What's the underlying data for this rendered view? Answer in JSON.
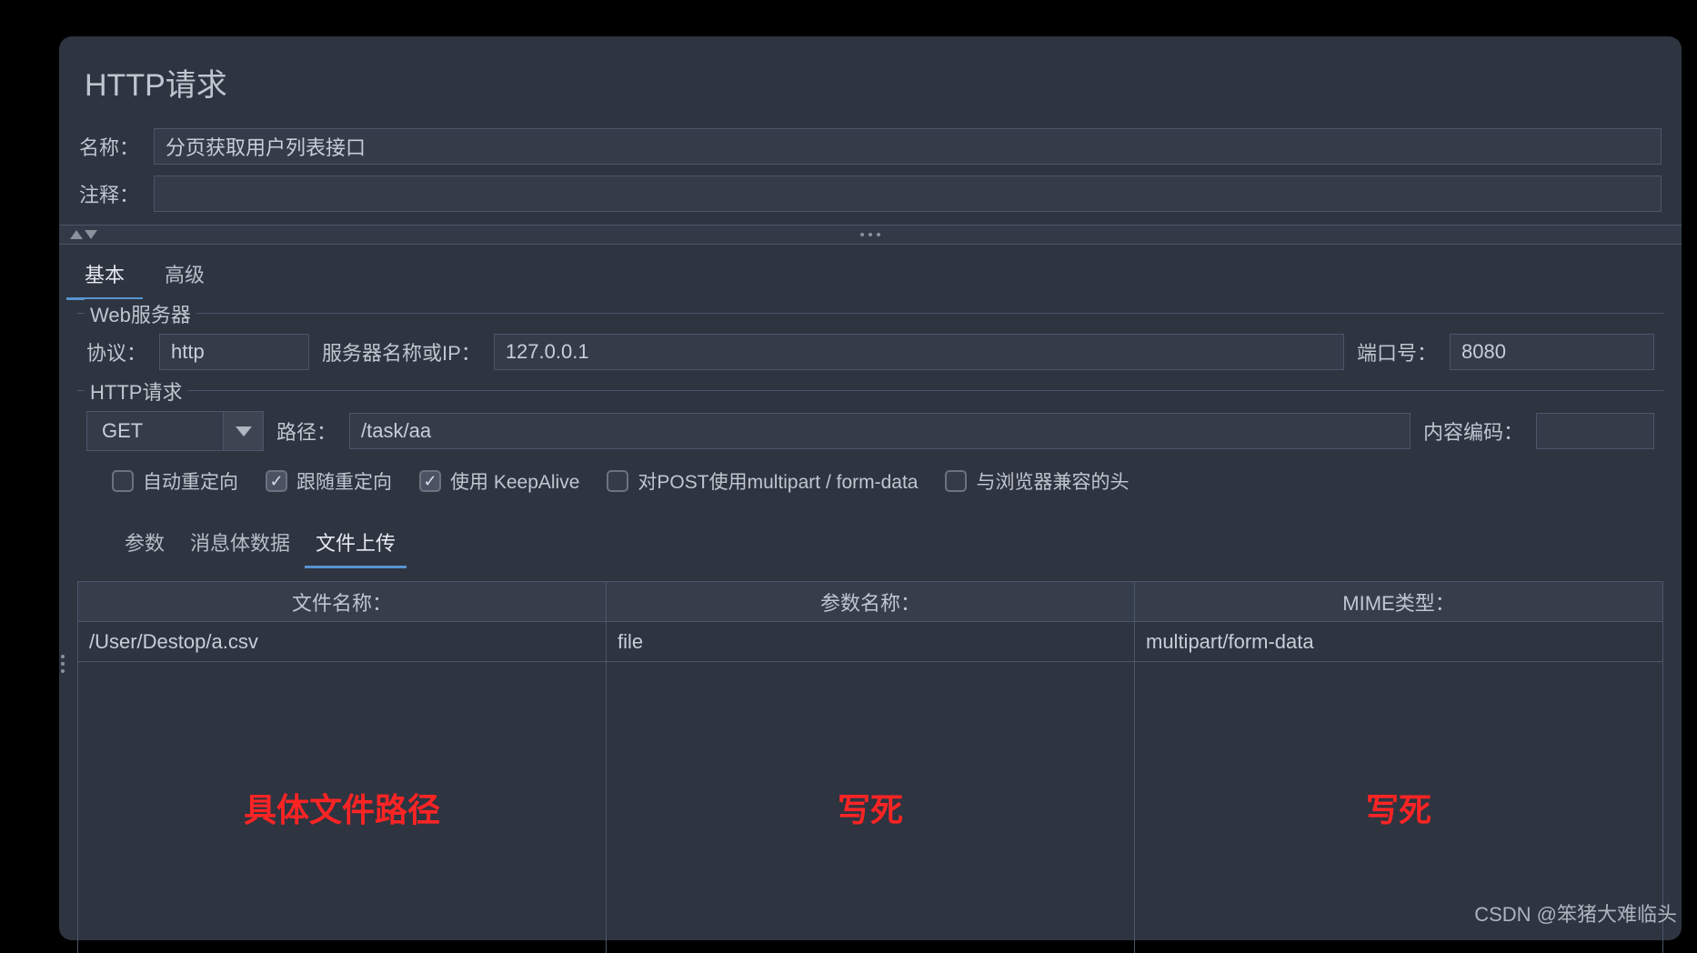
{
  "header": {
    "title": "HTTP请求",
    "name_label": "名称：",
    "name_value": "分页获取用户列表接口",
    "comment_label": "注释：",
    "comment_value": ""
  },
  "tabs": {
    "main": [
      "基本",
      "高级"
    ],
    "active_main": 0
  },
  "web_server": {
    "legend": "Web服务器",
    "protocol_label": "协议：",
    "protocol_value": "http",
    "server_label": "服务器名称或IP：",
    "server_value": "127.0.0.1",
    "port_label": "端口号：",
    "port_value": "8080"
  },
  "http_request": {
    "legend": "HTTP请求",
    "method_value": "GET",
    "path_label": "路径：",
    "path_value": "/task/aa",
    "encoding_label": "内容编码：",
    "encoding_value": ""
  },
  "checkboxes": [
    {
      "label": "自动重定向",
      "checked": false
    },
    {
      "label": "跟随重定向",
      "checked": true
    },
    {
      "label": "使用 KeepAlive",
      "checked": true
    },
    {
      "label": "对POST使用multipart / form-data",
      "checked": false
    },
    {
      "label": "与浏览器兼容的头",
      "checked": false
    }
  ],
  "inner_tabs": {
    "items": [
      "参数",
      "消息体数据",
      "文件上传"
    ],
    "active": 2
  },
  "file_table": {
    "headers": [
      "文件名称：",
      "参数名称：",
      "MIME类型："
    ],
    "row": [
      "/User/Destop/a.csv",
      "file",
      "multipart/form-data"
    ],
    "annotations": [
      "具体文件路径",
      "写死",
      "写死"
    ]
  },
  "watermark": "CSDN @笨猪大难临头"
}
